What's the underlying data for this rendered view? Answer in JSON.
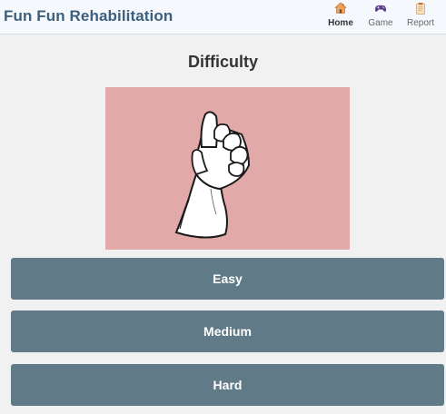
{
  "app": {
    "title": "Fun Fun Rehabilitation"
  },
  "nav": [
    {
      "label": "Home",
      "icon": "home-icon",
      "active": true
    },
    {
      "label": "Game",
      "icon": "gamepad-icon",
      "active": false
    },
    {
      "label": "Report",
      "icon": "clipboard-icon",
      "active": false
    }
  ],
  "main": {
    "title": "Difficulty",
    "image": "hand-gesture-icon",
    "buttons": {
      "easy": "Easy",
      "medium": "Medium",
      "hard": "Hard"
    }
  },
  "colors": {
    "header_bg": "#f5f9fd",
    "brand": "#3c5f7d",
    "button_bg": "#607b87",
    "image_bg": "#e2a9a9",
    "page_bg": "#f1f1f1"
  }
}
